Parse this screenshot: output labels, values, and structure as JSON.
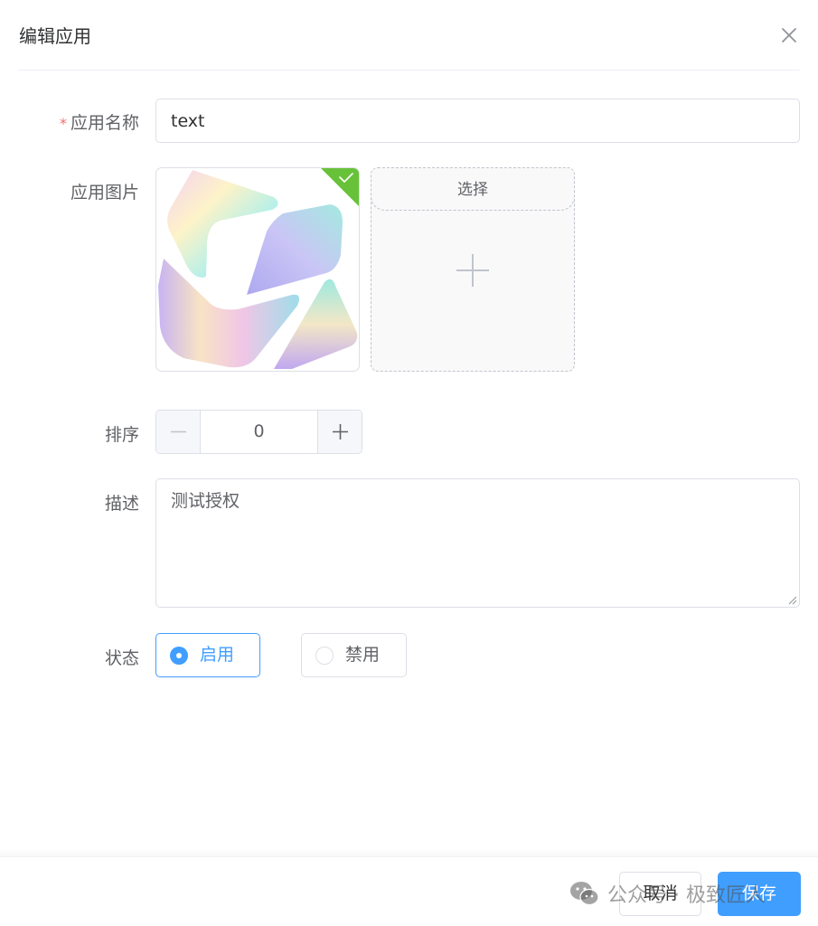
{
  "dialog": {
    "title": "编辑应用"
  },
  "form": {
    "name": {
      "label": "应用名称",
      "required_mark": "*",
      "value": "text"
    },
    "image": {
      "label": "应用图片",
      "select_label": "选择"
    },
    "sort": {
      "label": "排序",
      "value": "0",
      "minus": "−",
      "plus": "+"
    },
    "description": {
      "label": "描述",
      "value": "测试授权"
    },
    "status": {
      "label": "状态",
      "options": [
        {
          "label": "启用",
          "selected": true
        },
        {
          "label": "禁用",
          "selected": false
        }
      ]
    }
  },
  "footer": {
    "cancel_label": "取消",
    "save_label": "保存"
  },
  "watermark": {
    "text": "公众号 · 极致匠人"
  },
  "colors": {
    "primary": "#409eff",
    "success_badge": "#67c23a",
    "required": "#f56c6c"
  },
  "icons": [
    "close-icon",
    "check-icon",
    "plus-icon",
    "minus-icon",
    "resize-handle-icon",
    "wechat-icon"
  ]
}
